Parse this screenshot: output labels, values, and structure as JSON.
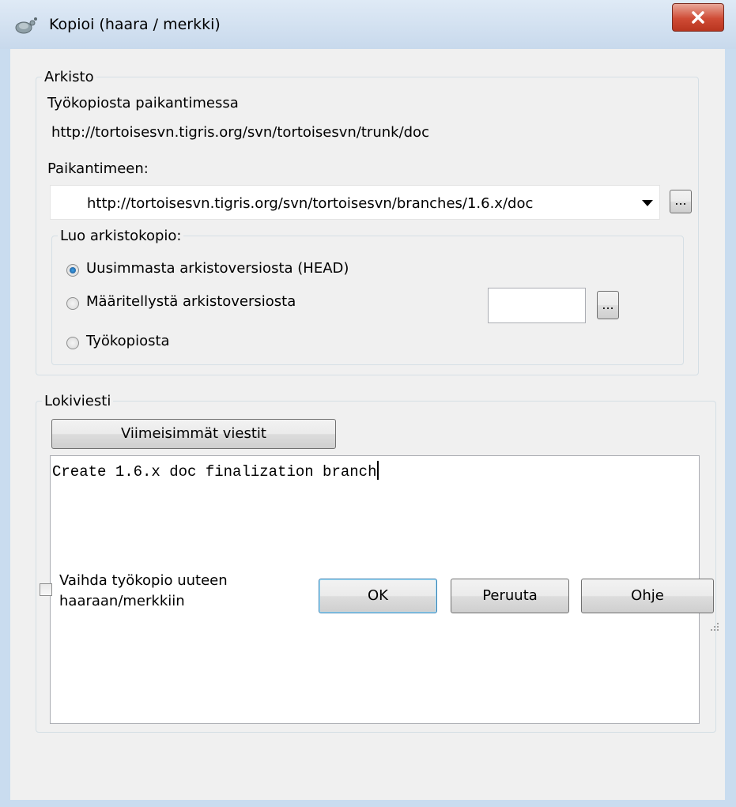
{
  "window": {
    "title": "Kopioi (haara / merkki)",
    "close_glyph": "X",
    "icon": "tortoisesvn-icon"
  },
  "repository": {
    "group_label": "Arkisto",
    "from_label": "Työkopiosta paikantimessa",
    "from_url": "http://tortoisesvn.tigris.org/svn/tortoisesvn/trunk/doc",
    "to_label": "Paikantimeen:",
    "to_url": "http://tortoisesvn.tigris.org/svn/tortoisesvn/branches/1.6.x/doc",
    "browse_label": "..."
  },
  "create_copy": {
    "group_label": "Luo arkistokopio:",
    "options": [
      {
        "label": "Uusimmasta arkistoversiosta (HEAD)",
        "checked": true
      },
      {
        "label": "Määritellystä arkistoversiosta",
        "checked": false
      },
      {
        "label": "Työkopiosta",
        "checked": false
      }
    ],
    "revision_value": "",
    "browse_label": "..."
  },
  "log": {
    "group_label": "Lokiviesti",
    "recent_button": "Viimeisimmät viestit",
    "message": "Create 1.6.x doc finalization branch"
  },
  "switch_checkbox": {
    "line1": "Vaihda työkopio uuteen",
    "line2": "haaraan/merkkiin",
    "checked": false
  },
  "buttons": {
    "ok": "OK",
    "cancel": "Peruuta",
    "help": "Ohje"
  }
}
